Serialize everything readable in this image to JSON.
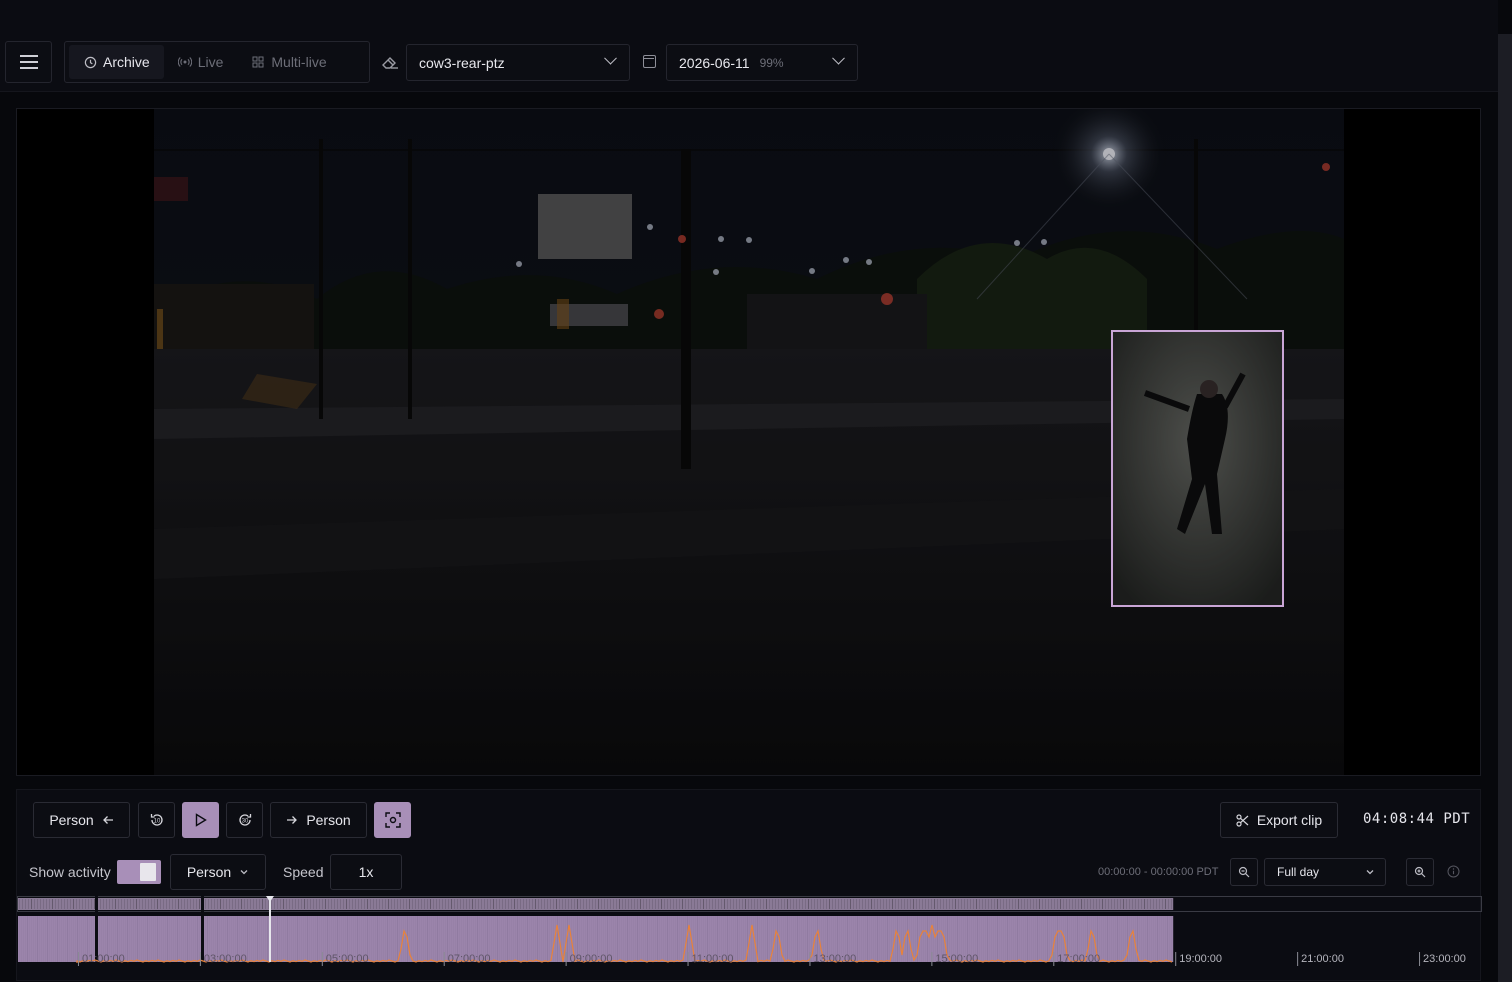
{
  "toolbar": {
    "mode_tabs": [
      {
        "label": "Archive",
        "icon": "clock-icon",
        "active": true
      },
      {
        "label": "Live",
        "icon": "broadcast-icon",
        "active": false
      },
      {
        "label": "Multi-live",
        "icon": "grid-icon",
        "active": false
      }
    ],
    "camera": {
      "value": "cow3-rear-ptz",
      "icon": "eraser-icon"
    },
    "date": {
      "value": "2026-06-11",
      "coverage": "99%",
      "icon": "calendar-icon"
    }
  },
  "player": {
    "prev_event_label": "Person",
    "next_event_label": "Person",
    "export_label": "Export clip",
    "timecode": "04:08:44 PDT",
    "rewind_label": "10",
    "forward_label": "30"
  },
  "filters": {
    "show_activity_label": "Show activity",
    "show_activity_on": true,
    "object_filter": "Person",
    "speed_label": "Speed",
    "speed_value": "1x",
    "range_text": "00:00:00 - 00:00:00 PDT",
    "zoom_preset": "Full day"
  },
  "timeline": {
    "hour_labels": [
      "01:00:00",
      "03:00:00",
      "05:00:00",
      "07:00:00",
      "09:00:00",
      "11:00:00",
      "13:00:00",
      "15:00:00",
      "17:00:00",
      "19:00:00",
      "21:00:00",
      "23:00:00"
    ],
    "recorded_until_hour": 19,
    "playhead_hour": 4.15,
    "colors": {
      "recorded": "#a88fb8",
      "activity": "#e8823a",
      "accent": "#c9a5d6"
    }
  }
}
